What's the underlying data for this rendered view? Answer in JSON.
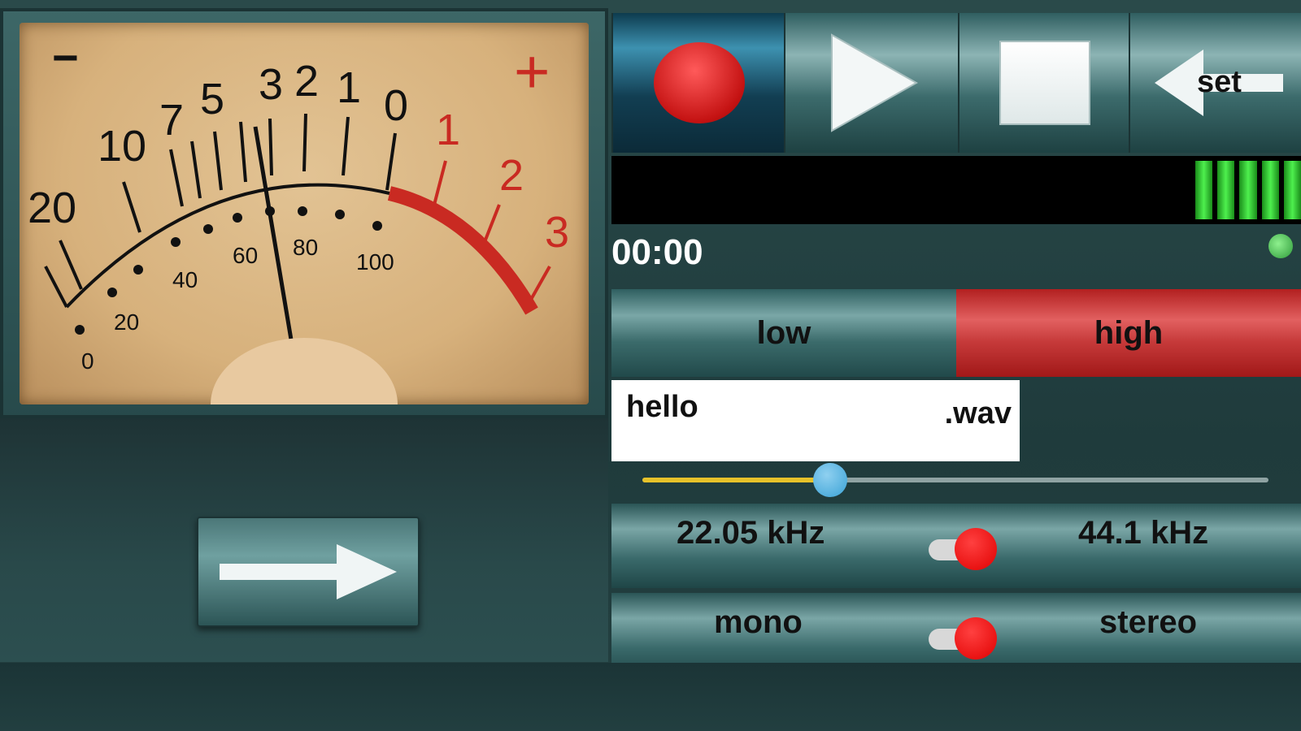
{
  "meter": {
    "minus_sign": "−",
    "plus_sign": "+",
    "db_scale": [
      "20",
      "10",
      "7",
      "5",
      "3",
      "2",
      "1",
      "0",
      "1",
      "2",
      "3"
    ],
    "percent_scale": [
      "0",
      "20",
      "40",
      "60",
      "80",
      "100"
    ]
  },
  "transport": {
    "set_label": "set"
  },
  "status": {
    "time": "00:00"
  },
  "quality": {
    "low_label": "low",
    "high_label": "high",
    "selected": "high"
  },
  "file": {
    "name": "hello",
    "extension": ".wav"
  },
  "gain": {
    "value_fraction": 0.3
  },
  "sample_rate": {
    "left_label": "22.05 kHz",
    "right_label": "44.1 kHz",
    "selected": "44.1 kHz"
  },
  "channels": {
    "left_label": "mono",
    "right_label": "stereo",
    "selected": "stereo"
  },
  "colors": {
    "accent_red": "#d42020",
    "level_green": "#3ee03e",
    "slider_fill": "#e6c22a",
    "slider_thumb": "#3aa2d6"
  }
}
